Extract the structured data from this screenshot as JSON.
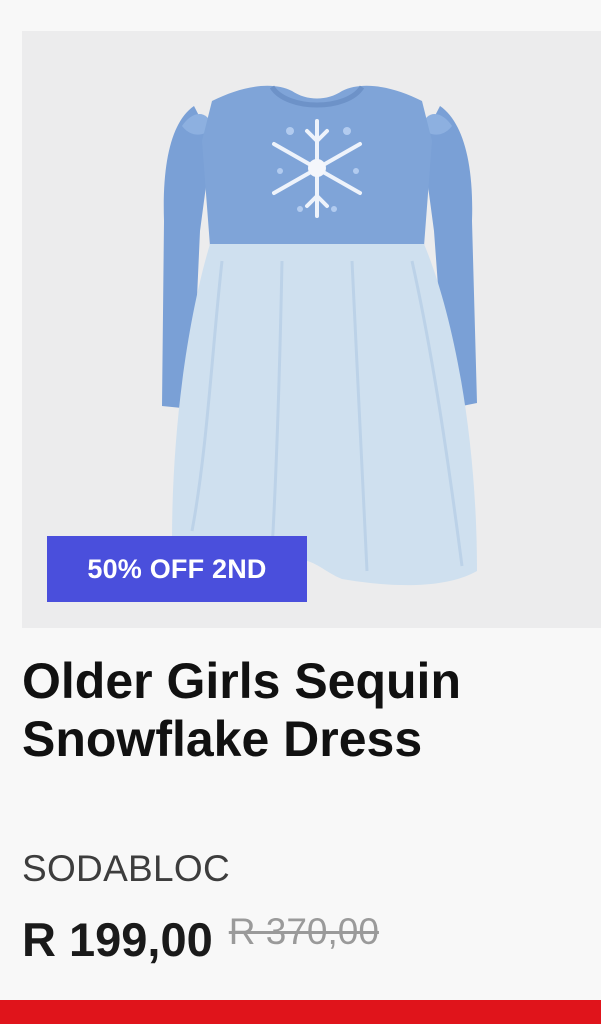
{
  "product": {
    "badge": "50% OFF 2ND",
    "title": "Older Girls Sequin Snowflake Dress",
    "brand": "SODABLOC",
    "price_current": "R 199,00",
    "price_old": "R 370,00",
    "image_icon": "dress-image"
  },
  "colors": {
    "badge_bg": "#4a4fdc",
    "accent_bar": "#e0141b",
    "dress_top": "#7fa4d8",
    "dress_skirt": "#cfe0ef"
  }
}
